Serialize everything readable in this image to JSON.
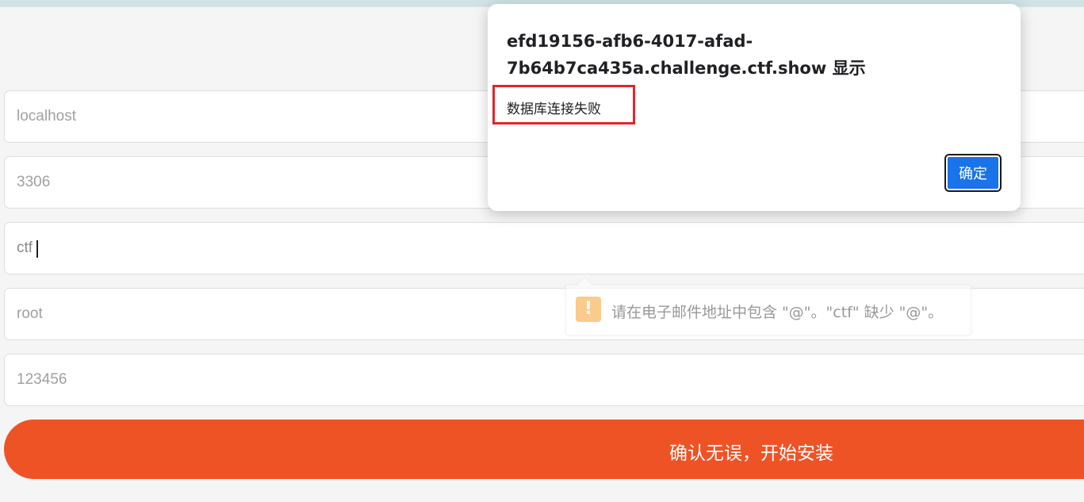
{
  "form": {
    "fields": [
      {
        "value": "",
        "placeholder": "localhost"
      },
      {
        "value": "",
        "placeholder": "3306"
      },
      {
        "value": "ctf",
        "placeholder": ""
      },
      {
        "value": "",
        "placeholder": "root"
      },
      {
        "value": "",
        "placeholder": "123456"
      }
    ],
    "submit_label": "确认无误，开始安装"
  },
  "validation_tooltip": {
    "icon": "warning-icon",
    "icon_glyph": "!",
    "text": "请在电子邮件地址中包含 \"@\"。\"ctf\" 缺少 \"@\"。"
  },
  "alert_dialog": {
    "title": "efd19156-afb6-4017-afad-7b64b7ca435a.challenge.ctf.show 显示",
    "message": "数据库连接失败",
    "ok_label": "确定"
  },
  "colors": {
    "submit_bg": "#ee5326",
    "ok_button_bg": "#1a73e8",
    "highlight_border": "#e3242b",
    "warning_icon": "#f6a12f"
  }
}
